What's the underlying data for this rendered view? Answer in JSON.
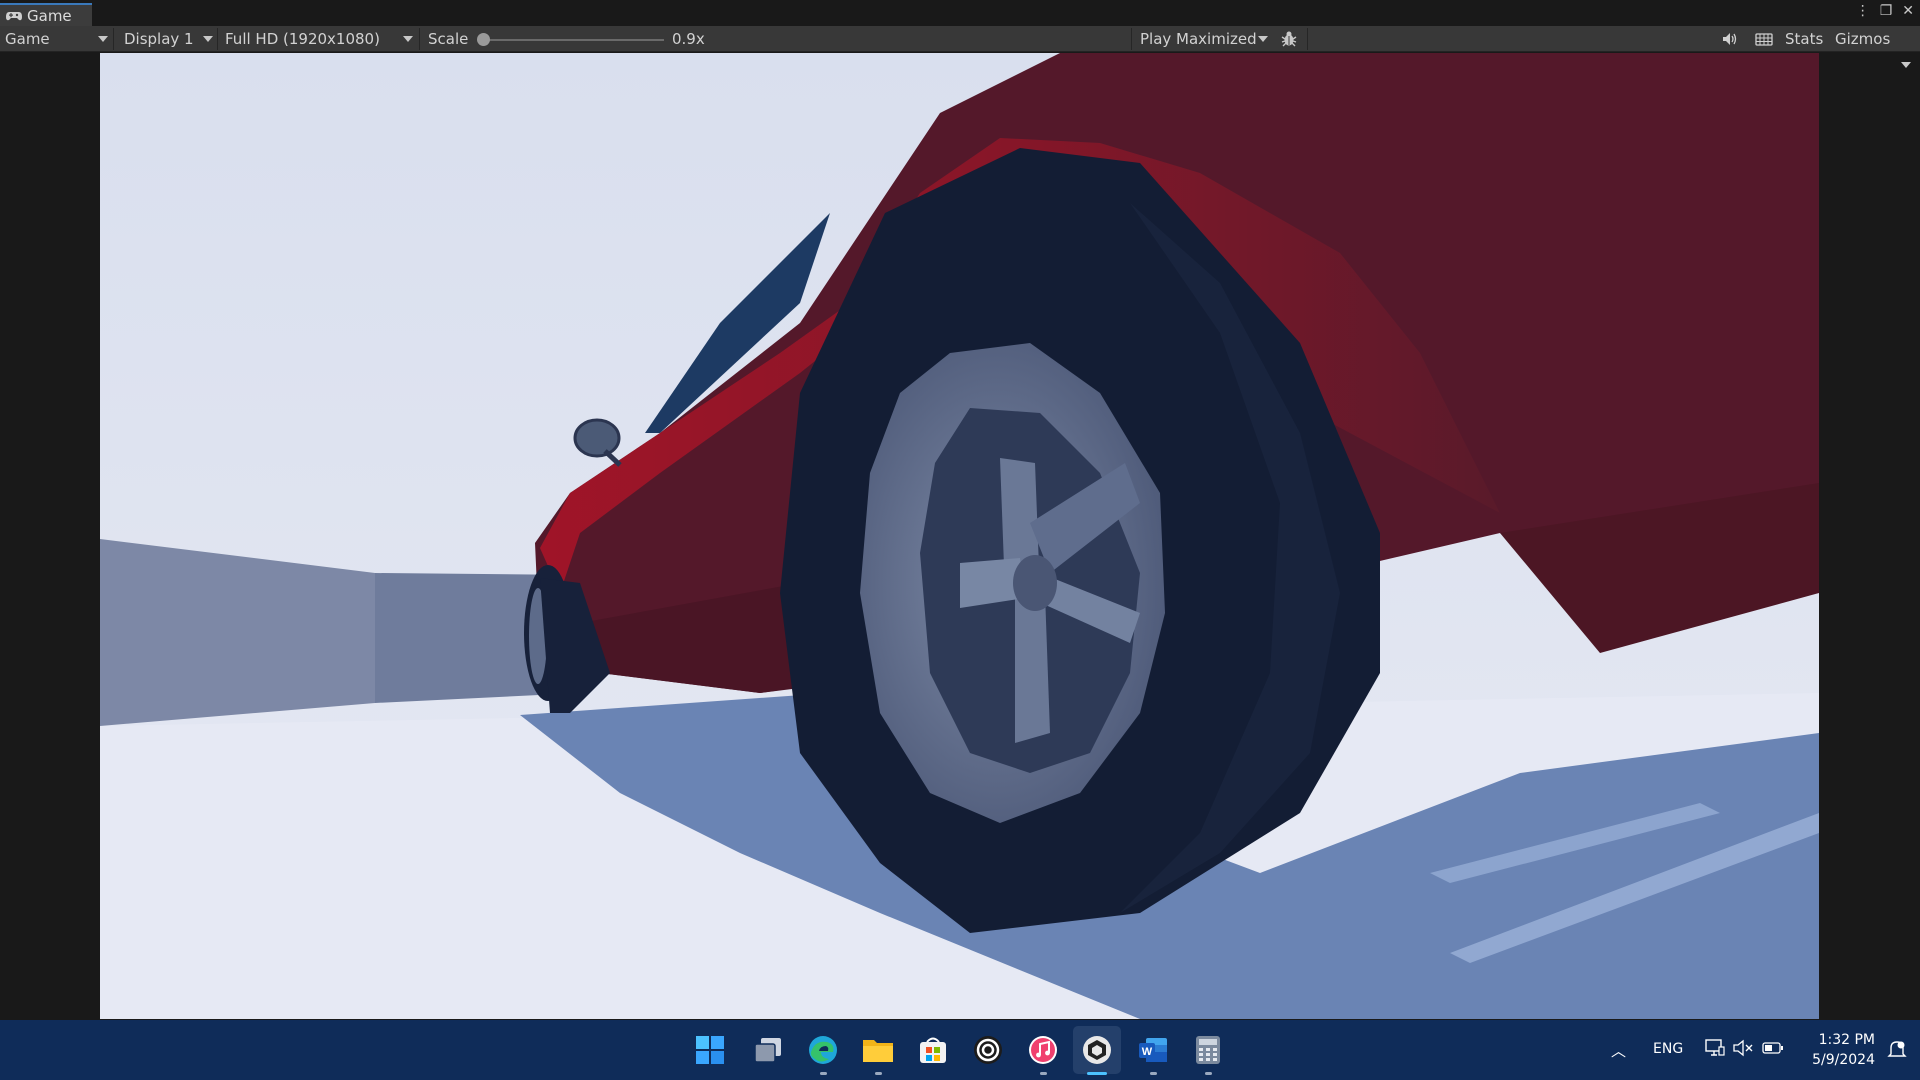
{
  "tab": {
    "title": "Game",
    "icon": "gamepad-icon"
  },
  "window_controls": [
    "more-icon",
    "maximize-icon",
    "close-icon"
  ],
  "toolbar": {
    "view_select": "Game",
    "display_select": "Display 1",
    "resolution_select": "Full HD (1920x1080)",
    "scale_label": "Scale",
    "scale_value": "0.9x",
    "scale_fraction": 0.0,
    "play_mode": "Play Maximized",
    "stats_label": "Stats",
    "gizmos_label": "Gizmos",
    "icons": [
      "bug-icon",
      "speaker-icon",
      "keyboard-icon"
    ]
  },
  "scene": {
    "description_colors": {
      "car_body": "#5a1a28",
      "car_highlight": "#c8142a",
      "tire": "#16213a",
      "rim": "#5c6a88",
      "sky": "#dde2ee",
      "ground": "#e6e9f3",
      "shadow": "#6d86b4",
      "wall": "#7f8ba8"
    }
  },
  "taskbar": {
    "apps": [
      "windows-start-icon",
      "task-view-icon",
      "edge-icon",
      "file-explorer-icon",
      "store-icon",
      "app-circle-icon",
      "itunes-icon",
      "unity-icon",
      "word-icon",
      "calculator-icon"
    ],
    "tray": {
      "language": "ENG",
      "time": "1:32 PM",
      "date": "5/9/2024"
    }
  },
  "colors": {
    "taskbar": "#0f2c59",
    "toolbar": "#383838",
    "tab_accent": "#3a79bb"
  }
}
